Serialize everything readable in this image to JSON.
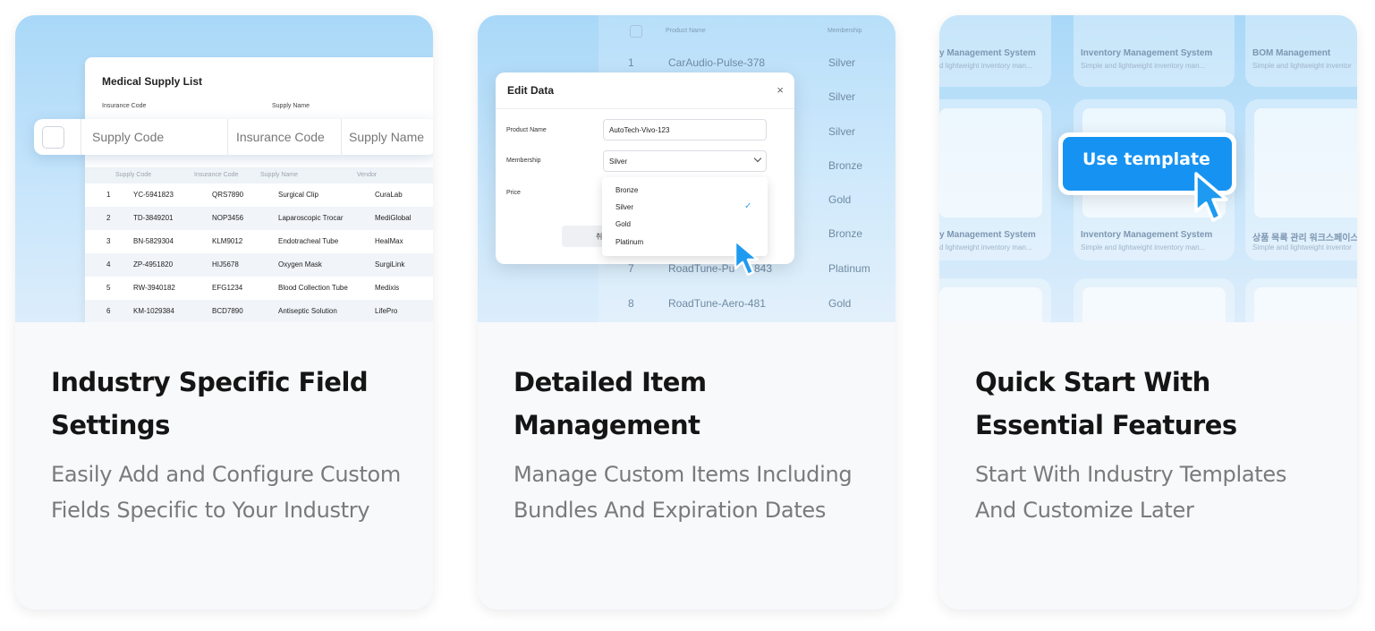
{
  "cards": [
    {
      "title": "Industry Specific Field Settings",
      "description": "Easily Add and Configure Custom Fields Specific to Your Industry",
      "preview": {
        "sheet_title": "Medical Supply List",
        "filter_labels": [
          "Insurance Code",
          "Supply Name"
        ],
        "filterbar": [
          "Supply Code",
          "Insurance Code",
          "Supply Name"
        ],
        "columns": [
          "Supply Code",
          "Insurance Code",
          "Supply Name",
          "Vendor"
        ],
        "rows": [
          [
            "1",
            "YC-5941823",
            "QRS7890",
            "Surgical Clip",
            "CuraLab"
          ],
          [
            "2",
            "TD-3849201",
            "NOP3456",
            "Laparoscopic Trocar",
            "MediGlobal"
          ],
          [
            "3",
            "BN-5829304",
            "KLM9012",
            "Endotracheal Tube",
            "HealMax"
          ],
          [
            "4",
            "ZP-4951820",
            "HIJ5678",
            "Oxygen Mask",
            "SurgiLink"
          ],
          [
            "5",
            "RW-3940182",
            "EFG1234",
            "Blood Collection Tube",
            "Medixis"
          ],
          [
            "6",
            "KM-1029384",
            "BCD7890",
            "Antiseptic Solution",
            "LifePro"
          ]
        ]
      }
    },
    {
      "title": "Detailed Item Management",
      "description": "Manage Custom Items Including Bundles And Expiration Dates",
      "preview": {
        "bg_columns": [
          "Product Name",
          "Membership"
        ],
        "bg_rows": [
          [
            "1",
            "CarAudio-Pulse-378",
            "Silver"
          ],
          [
            "",
            "",
            "Silver"
          ],
          [
            "",
            "",
            "Silver"
          ],
          [
            "",
            "",
            "Bronze"
          ],
          [
            "",
            "",
            "Gold"
          ],
          [
            "",
            "",
            "Bronze"
          ],
          [
            "7",
            "RoadTune-Pu",
            "843",
            "Platinum"
          ],
          [
            "8",
            "RoadTune-Aero-481",
            "Gold"
          ]
        ],
        "modal_title": "Edit Data",
        "close_glyph": "×",
        "fields": {
          "product_label": "Product Name",
          "product_value": "AutoTech-Vivo-123",
          "membership_label": "Membership",
          "membership_value": "Silver",
          "price_label": "Price"
        },
        "cancel_partial": "취",
        "options": [
          "Bronze",
          "Silver",
          "Gold",
          "Platinum"
        ],
        "check_glyph": "✓"
      }
    },
    {
      "title": "Quick Start With Essential Features",
      "description": "Start With Industry Templates And Customize Later",
      "preview": {
        "button_label": "Use template",
        "templates_top": [
          {
            "title": "y Management System",
            "sub": "d lightweight inventory man..."
          },
          {
            "title": "Inventory Management System",
            "sub": "Simple and lightweight inventory man..."
          },
          {
            "title": "BOM Management",
            "sub": "Simple and lightweight inventor"
          }
        ],
        "templates_mid": [
          {
            "title": "y Management System",
            "sub": "d lightweight inventory man..."
          },
          {
            "title": "Inventory Management System",
            "sub": "Simple and lightweight inventory man..."
          },
          {
            "title": "상품 목록 관리 워크스페이스 템",
            "sub": "Simple and lightweight inventor"
          }
        ]
      }
    }
  ],
  "colors": {
    "accent": "#1693f2",
    "preview_bg": "#a9d8f8",
    "title": "#151515",
    "description": "#7a7a7a"
  }
}
